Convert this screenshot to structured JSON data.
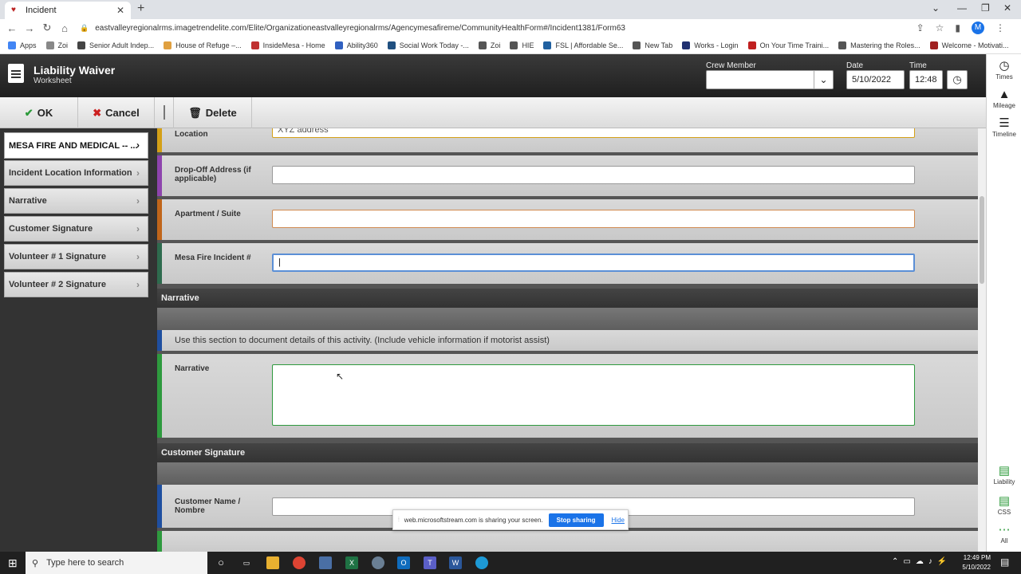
{
  "browser": {
    "tab_title": "Incident",
    "url": "eastvalleyregionalrms.imagetrendelite.com/Elite/Organizationeastvalleyregionalrms/Agencymesafireme/CommunityHealthForm#/Incident1381/Form63",
    "bookmarks": [
      {
        "label": "Apps",
        "color": "#4285f4"
      },
      {
        "label": "Zoi",
        "color": "#888888"
      },
      {
        "label": "Senior Adult Indep...",
        "color": "#444444"
      },
      {
        "label": "House of Refuge –...",
        "color": "#e0a040"
      },
      {
        "label": "InsideMesa - Home",
        "color": "#c03030"
      },
      {
        "label": "Ability360",
        "color": "#3060c0"
      },
      {
        "label": "Social Work Today -...",
        "color": "#205080"
      },
      {
        "label": "Zoi",
        "color": "#555555"
      },
      {
        "label": "HIE",
        "color": "#555555"
      },
      {
        "label": "FSL | Affordable Se...",
        "color": "#2060a0"
      },
      {
        "label": "New Tab",
        "color": "#555555"
      },
      {
        "label": "Works - Login",
        "color": "#203070"
      },
      {
        "label": "On Your Time Traini...",
        "color": "#c02020"
      },
      {
        "label": "Mastering the Roles...",
        "color": "#555555"
      },
      {
        "label": "Welcome - Motivati...",
        "color": "#a02020"
      }
    ]
  },
  "header": {
    "title": "Liability Waiver",
    "subtitle": "Worksheet",
    "crew_label": "Crew Member",
    "date_label": "Date",
    "date_value": "5/10/2022",
    "time_label": "Time",
    "time_value": "12:48"
  },
  "toolbar": {
    "ok_label": "OK",
    "cancel_label": "Cancel",
    "delete_label": "Delete"
  },
  "nav": [
    {
      "label": "MESA FIRE AND MEDICAL -- ..."
    },
    {
      "label": "Incident Location Information"
    },
    {
      "label": "Narrative"
    },
    {
      "label": "Customer Signature"
    },
    {
      "label": "Volunteer # 1 Signature"
    },
    {
      "label": "Volunteer # 2 Signature"
    }
  ],
  "form": {
    "location_label": "Location",
    "location_value": "XYZ address",
    "dropoff_label": "Drop-Off Address (if applicable)",
    "apartment_label": "Apartment / Suite",
    "incident_label": "Mesa Fire Incident #",
    "narrative_section": "Narrative",
    "narrative_note": "Use this section to document details of this activity. (Include vehicle information if motorist assist)",
    "narrative_label": "Narrative",
    "signature_section": "Customer Signature",
    "customer_name_label": "Customer Name / Nombre"
  },
  "rail": {
    "times": "Times",
    "mileage": "Mileage",
    "timeline": "Timeline",
    "liability": "Liability",
    "css": "CSS",
    "all": "All"
  },
  "share_banner": {
    "text": "web.microsoftstream.com is sharing your screen.",
    "stop": "Stop sharing",
    "hide": "Hide"
  },
  "taskbar": {
    "search_placeholder": "Type here to search",
    "time": "12:49 PM",
    "date": "5/10/2022"
  },
  "colors": {
    "location_bar": "#d4a017",
    "dropoff_bar": "#8e44ad",
    "apartment_bar": "#c0651a",
    "incident_bar": "#2e6b4e",
    "narrative_note_bar": "#1f4fa0",
    "narrative_bar": "#2e9a3e",
    "customer_bar": "#1f4fa0"
  }
}
